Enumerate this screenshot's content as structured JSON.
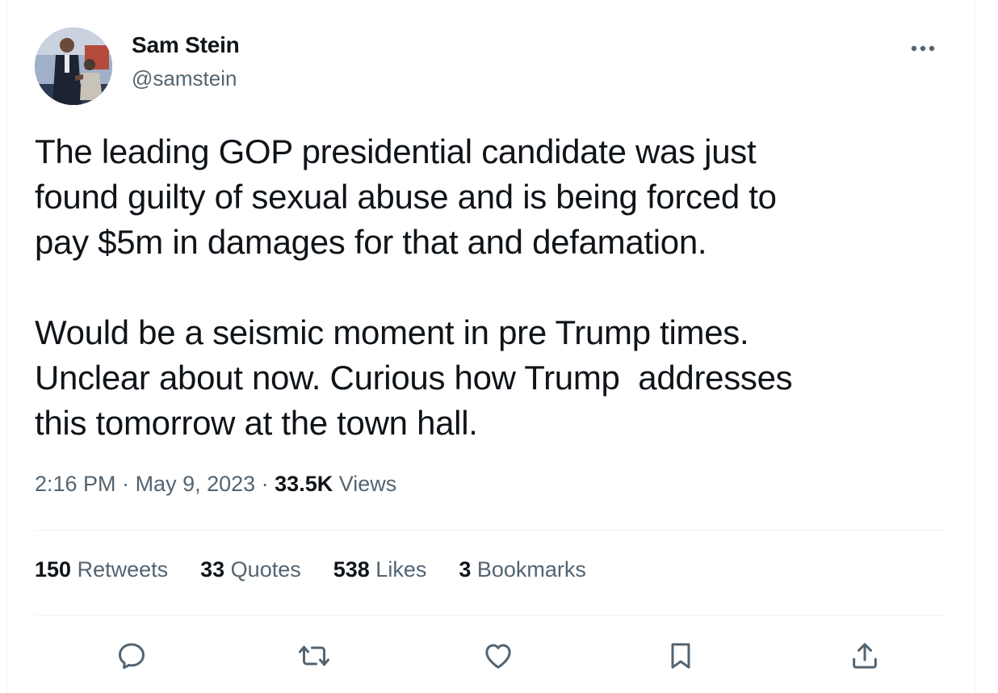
{
  "author": {
    "name": "Sam Stein",
    "handle": "@samstein"
  },
  "tweet": {
    "text": "The leading GOP presidential candidate was just\nfound guilty of sexual abuse and is being forced to\npay $5m in damages for that and defamation.\n\nWould be a seismic moment in pre Trump times.\nUnclear about now. Curious how Trump  addresses\nthis tomorrow at the town hall."
  },
  "meta": {
    "time": "2:16 PM",
    "sep1": " · ",
    "date": "May 9, 2023",
    "sep2": " · ",
    "views_count": "33.5K",
    "views_label": " Views"
  },
  "stats": {
    "retweets": {
      "num": "150",
      "label": " Retweets"
    },
    "quotes": {
      "num": "33",
      "label": " Quotes"
    },
    "likes": {
      "num": "538",
      "label": " Likes"
    },
    "bookmarks": {
      "num": "3",
      "label": " Bookmarks"
    }
  },
  "icons": {
    "more": "more-icon",
    "reply": "reply-icon",
    "retweet": "retweet-icon",
    "like": "like-icon",
    "bookmark": "bookmark-icon",
    "share": "share-icon"
  },
  "colors": {
    "text": "#0f1419",
    "secondary": "#536471",
    "divider": "#eff3f4"
  }
}
